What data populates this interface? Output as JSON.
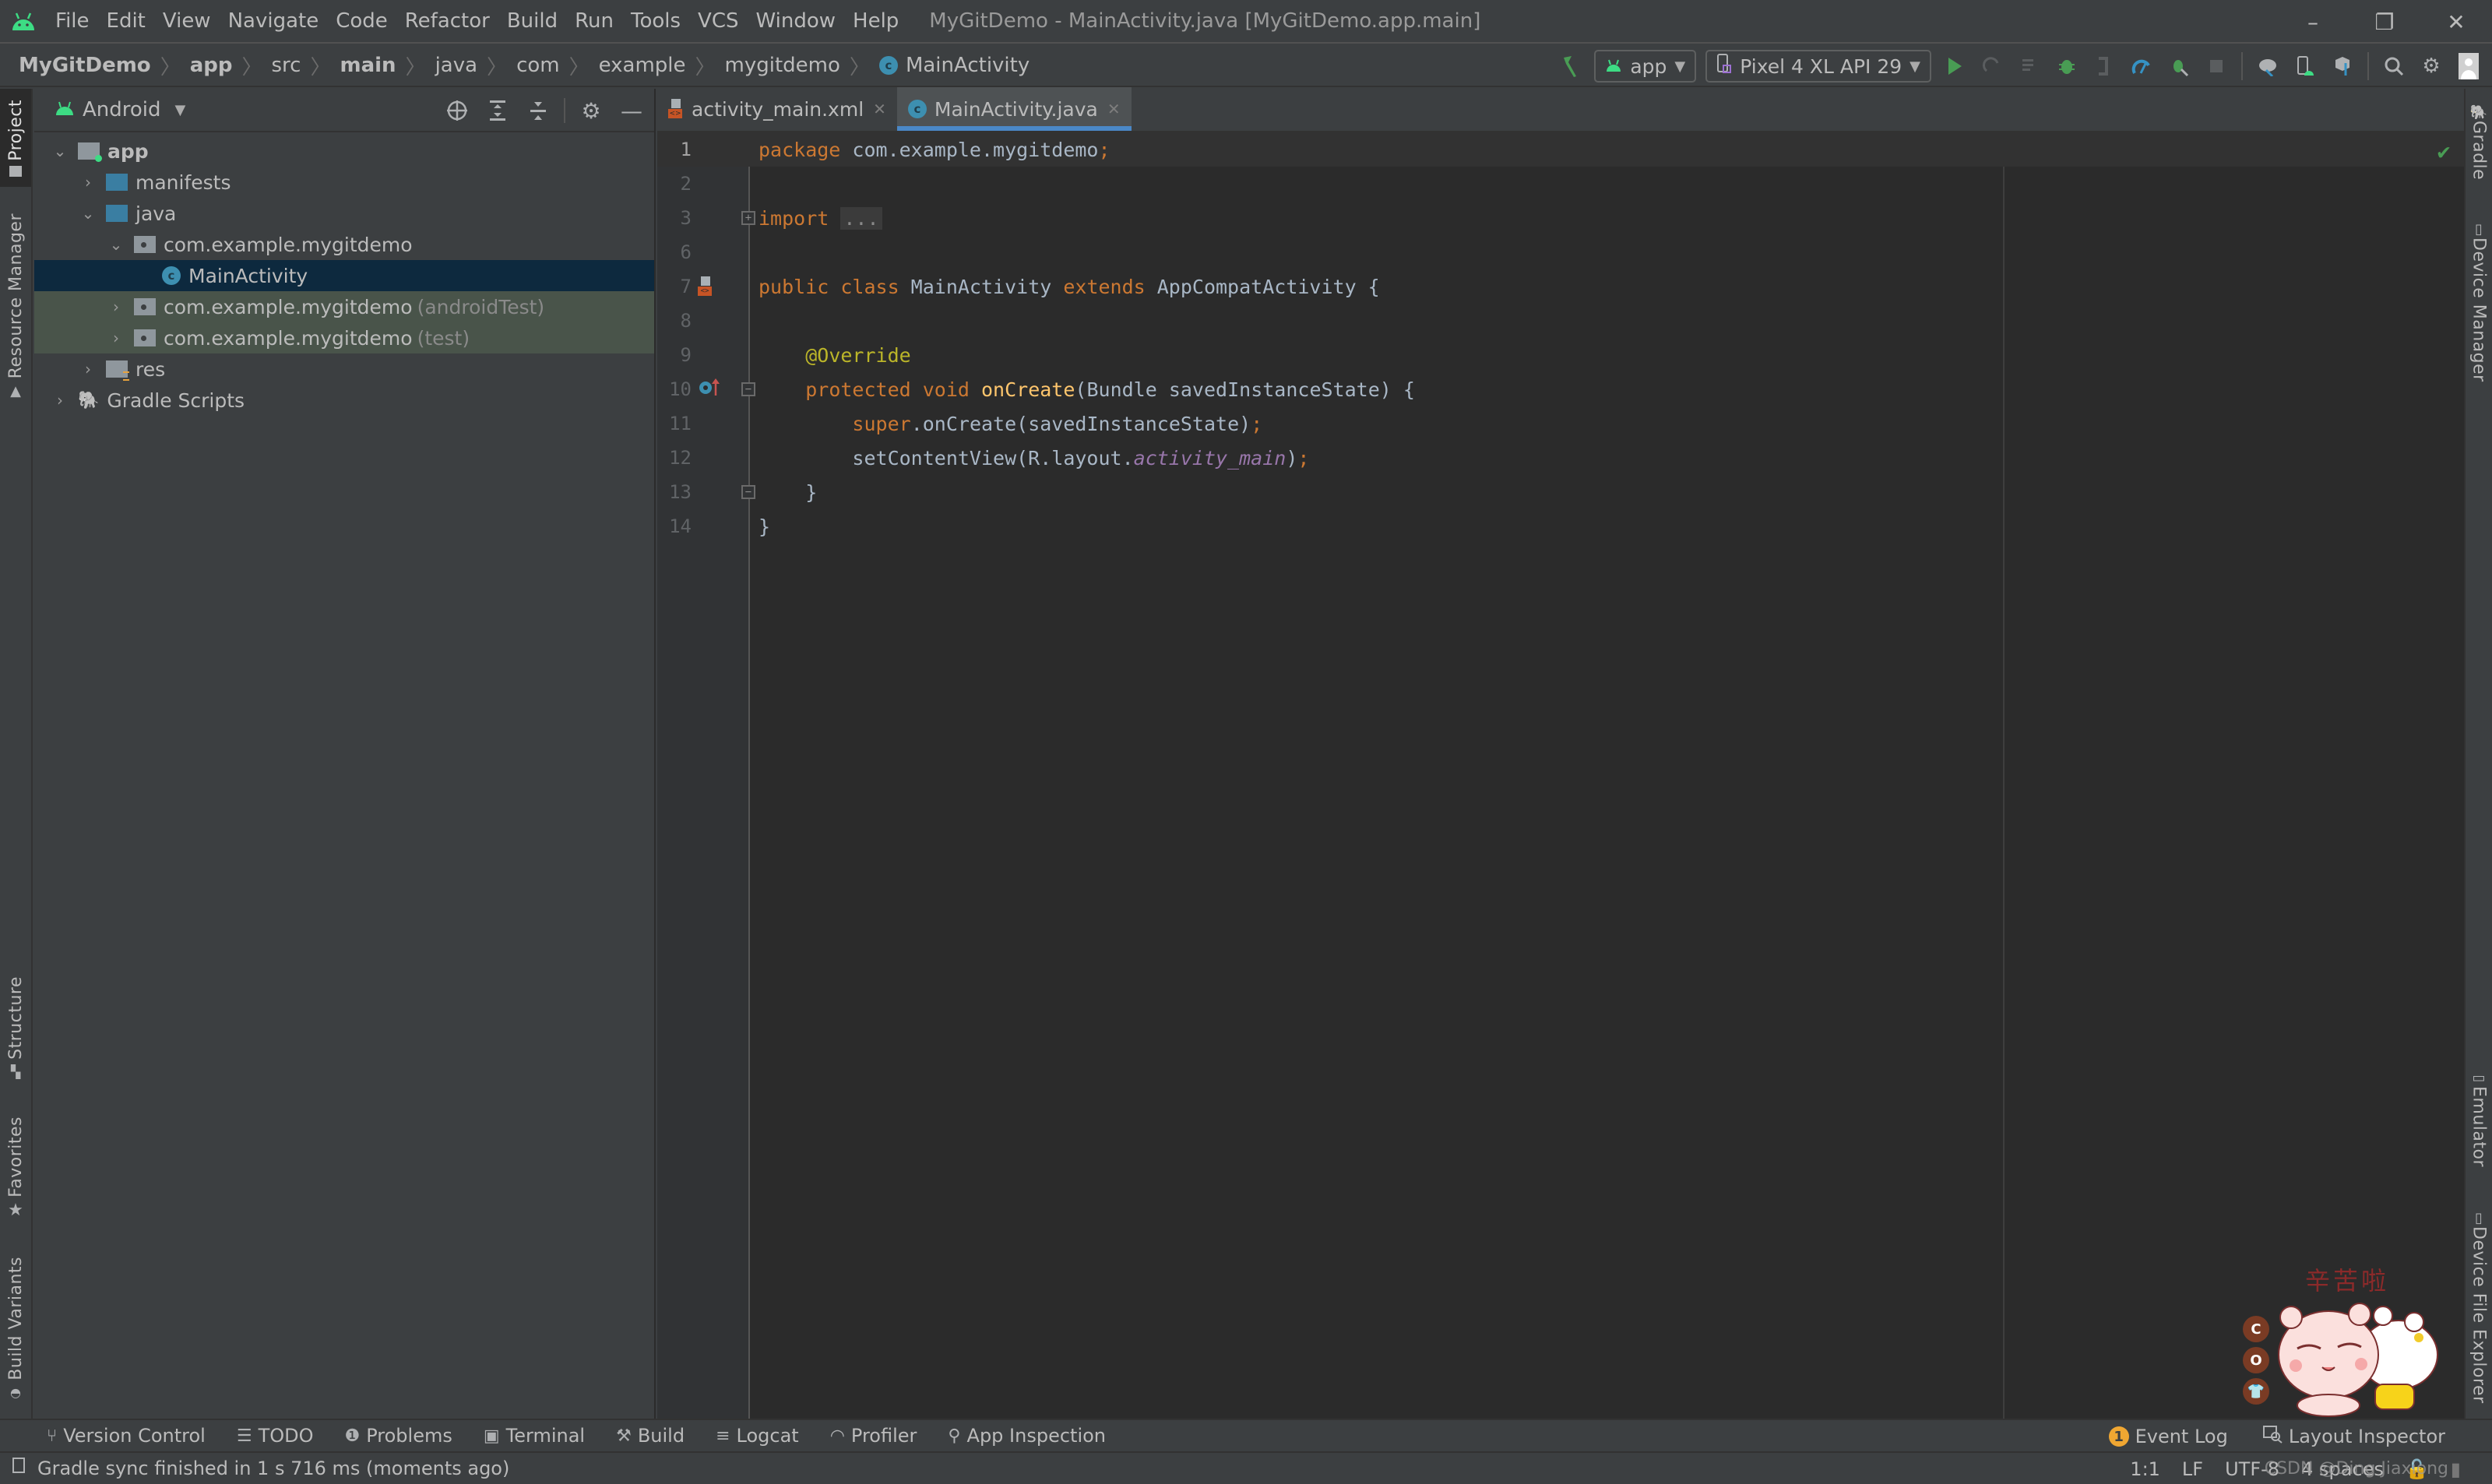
{
  "window": {
    "title": "MyGitDemo - MainActivity.java [MyGitDemo.app.main]",
    "controls": {
      "minimize": "–",
      "restore": "❐",
      "close": "✕"
    }
  },
  "menu": [
    {
      "label": "File"
    },
    {
      "label": "Edit"
    },
    {
      "label": "View"
    },
    {
      "label": "Navigate"
    },
    {
      "label": "Code"
    },
    {
      "label": "Refactor"
    },
    {
      "label": "Build"
    },
    {
      "label": "Run"
    },
    {
      "label": "Tools"
    },
    {
      "label": "VCS"
    },
    {
      "label": "Window"
    },
    {
      "label": "Help"
    }
  ],
  "breadcrumb": [
    {
      "label": "MyGitDemo",
      "bold": true
    },
    {
      "label": "app",
      "bold": true
    },
    {
      "label": "src",
      "bold": false
    },
    {
      "label": "main",
      "bold": true
    },
    {
      "label": "java",
      "bold": false
    },
    {
      "label": "com",
      "bold": false
    },
    {
      "label": "example",
      "bold": false
    },
    {
      "label": "mygitdemo",
      "bold": false
    },
    {
      "label": "MainActivity",
      "bold": false,
      "icon": "class-icon"
    }
  ],
  "toolbar": {
    "run_config": "app",
    "device": "Pixel 4 XL API 29",
    "icons": [
      "build-hammer-icon",
      "run-icon",
      "apply-changes-icon",
      "apply-code-changes-icon",
      "debug-icon",
      "attach-debugger-icon",
      "profile-icon",
      "debug-attach-icon",
      "stop-icon",
      "sync-gradle-icon",
      "avd-manager-icon",
      "sdk-manager-icon",
      "search-icon",
      "settings-icon",
      "account-icon"
    ]
  },
  "left_stripe": {
    "top": [
      {
        "label": "Project",
        "icon": "folder-icon"
      },
      {
        "label": "Resource Manager",
        "icon": "resource-manager-icon"
      }
    ],
    "bottom": [
      {
        "label": "Structure",
        "icon": "structure-icon"
      },
      {
        "label": "Favorites",
        "icon": "star-icon"
      },
      {
        "label": "Build Variants",
        "icon": "android-icon"
      }
    ]
  },
  "right_stripe": {
    "top": [
      {
        "label": "Gradle",
        "icon": "gradle-icon"
      },
      {
        "label": "Device Manager",
        "icon": "device-manager-icon"
      }
    ],
    "bottom": [
      {
        "label": "Emulator",
        "icon": "emulator-icon"
      },
      {
        "label": "Device File Explorer",
        "icon": "device-file-explorer-icon"
      }
    ]
  },
  "project_panel": {
    "view": "Android",
    "tree": [
      {
        "label": "app",
        "depth": 0,
        "expanded": true,
        "type": "module",
        "bold": true
      },
      {
        "label": "manifests",
        "depth": 1,
        "expanded": false,
        "type": "folder-blue"
      },
      {
        "label": "java",
        "depth": 1,
        "expanded": true,
        "type": "folder-blue"
      },
      {
        "label": "com.example.mygitdemo",
        "depth": 2,
        "expanded": true,
        "type": "package"
      },
      {
        "label": "MainActivity",
        "depth": 3,
        "type": "class",
        "selected": true
      },
      {
        "label": "com.example.mygitdemo",
        "suffix": "(androidTest)",
        "depth": 2,
        "expanded": false,
        "type": "package",
        "test": true
      },
      {
        "label": "com.example.mygitdemo",
        "suffix": "(test)",
        "depth": 2,
        "expanded": false,
        "type": "package",
        "test": true
      },
      {
        "label": "res",
        "depth": 1,
        "expanded": false,
        "type": "res"
      },
      {
        "label": "Gradle Scripts",
        "depth": 0,
        "expanded": false,
        "type": "gradle"
      }
    ]
  },
  "editor": {
    "tabs": [
      {
        "label": "activity_main.xml",
        "active": false,
        "icon": "xml-layout-icon"
      },
      {
        "label": "MainActivity.java",
        "active": true,
        "icon": "class-icon"
      }
    ],
    "lines": [
      {
        "n": "1",
        "tokens": [
          [
            "kw",
            "package"
          ],
          [
            "p",
            " com.example.mygitdemo"
          ],
          [
            "kw",
            ";"
          ]
        ]
      },
      {
        "n": "2",
        "tokens": []
      },
      {
        "n": "3",
        "tokens": [
          [
            "kw",
            "import"
          ],
          [
            "p",
            " "
          ],
          [
            "fold",
            "..."
          ]
        ]
      },
      {
        "n": "6",
        "tokens": []
      },
      {
        "n": "7",
        "tokens": [
          [
            "kw",
            "public class"
          ],
          [
            "p",
            " MainActivity "
          ],
          [
            "kw",
            "extends"
          ],
          [
            "p",
            " AppCompatActivity {"
          ]
        ]
      },
      {
        "n": "8",
        "tokens": []
      },
      {
        "n": "9",
        "tokens": [
          [
            "p",
            "    "
          ],
          [
            "ann",
            "@Override"
          ]
        ]
      },
      {
        "n": "10",
        "tokens": [
          [
            "p",
            "    "
          ],
          [
            "kw",
            "protected void"
          ],
          [
            "p",
            " "
          ],
          [
            "fn",
            "onCreate"
          ],
          [
            "p",
            "(Bundle savedInstanceState) {"
          ]
        ]
      },
      {
        "n": "11",
        "tokens": [
          [
            "p",
            "        "
          ],
          [
            "kw",
            "super"
          ],
          [
            "p",
            ".onCreate(savedInstanceState)"
          ],
          [
            "kw",
            ";"
          ]
        ]
      },
      {
        "n": "12",
        "tokens": [
          [
            "p",
            "        setContentView(R.layout."
          ],
          [
            "fld",
            "activity_main"
          ],
          [
            "p",
            ")"
          ],
          [
            "kw",
            ";"
          ]
        ]
      },
      {
        "n": "13",
        "tokens": [
          [
            "p",
            "    }"
          ]
        ]
      },
      {
        "n": "14",
        "tokens": [
          [
            "p",
            "}"
          ]
        ]
      }
    ],
    "inspection_status": "no-problems-checkmark"
  },
  "sticker": {
    "caption": "辛苦啦",
    "badges": [
      "C",
      "O",
      "👕"
    ]
  },
  "tool_windows": {
    "left": [
      {
        "label": "Version Control",
        "icon": "branch-icon"
      },
      {
        "label": "TODO",
        "icon": "list-icon"
      },
      {
        "label": "Problems",
        "icon": "problems-icon"
      },
      {
        "label": "Terminal",
        "icon": "terminal-icon"
      },
      {
        "label": "Build",
        "icon": "hammer-icon"
      },
      {
        "label": "Logcat",
        "icon": "logcat-icon"
      },
      {
        "label": "Profiler",
        "icon": "profiler-icon"
      },
      {
        "label": "App Inspection",
        "icon": "app-inspection-icon"
      }
    ],
    "right": [
      {
        "label": "Event Log",
        "badge": "1"
      },
      {
        "label": "Layout Inspector",
        "icon": "layout-inspector-icon"
      }
    ]
  },
  "statusbar": {
    "message": "Gradle sync finished in 1 s 716 ms (moments ago)",
    "position": "1:1",
    "line_separator": "LF",
    "encoding": "UTF-8",
    "indent": "4 spaces",
    "watermark": "CSDN @Ding Jiaxiong"
  }
}
